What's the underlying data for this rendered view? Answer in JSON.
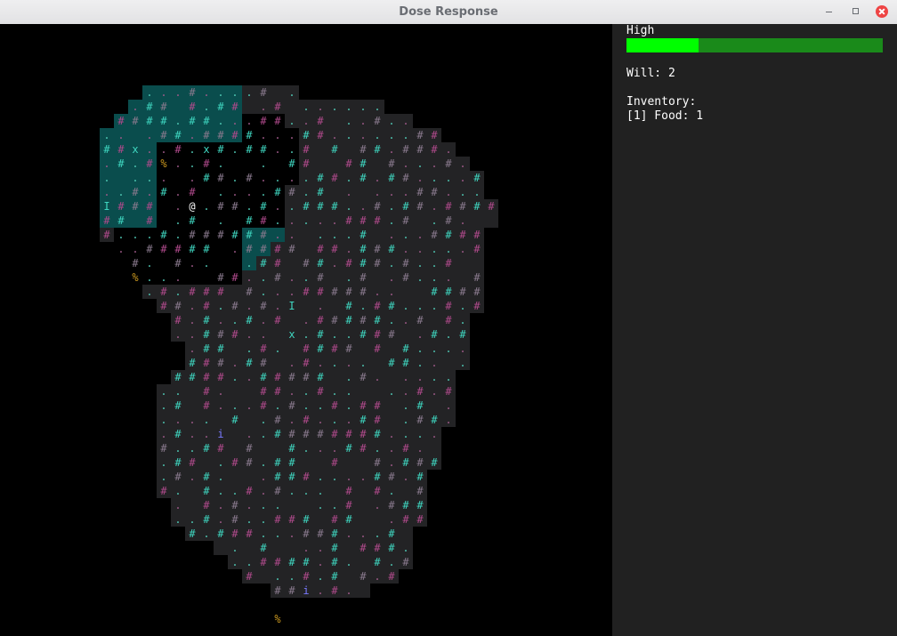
{
  "window": {
    "title": "Dose Response"
  },
  "sidebar": {
    "dose_label": "High",
    "dose_level": 0.28,
    "bar_fill_color": "#00ff00",
    "bar_empty_color": "#1a8a1a",
    "will": "Will: 2",
    "inventory_header": "Inventory:",
    "inventory_items": [
      "[1] Food: 1"
    ]
  },
  "map": {
    "player_glyph": "@",
    "colors": {
      "background": "#000000",
      "floor": "#232325",
      "highlight_floor": "#0a4d4d",
      "player": "#ffffff",
      "tree_teal": "#3fd6c0",
      "tree_pink": "#b04a8c",
      "tree_grey": "#8a7a8e",
      "dot_teal": "#4fc8b4",
      "dot_pink": "#a05a8a",
      "food": "#c8961e",
      "monster_teal": "#3fd6c0",
      "item_blue": "#7a7aff"
    },
    "markers": [
      {
        "glyph": "x",
        "kind": "monster"
      },
      {
        "glyph": "x",
        "kind": "monster"
      },
      {
        "glyph": "x",
        "kind": "monster"
      },
      {
        "glyph": "I",
        "kind": "monster"
      },
      {
        "glyph": "I",
        "kind": "monster"
      },
      {
        "glyph": "i",
        "kind": "item"
      },
      {
        "glyph": "i",
        "kind": "item"
      },
      {
        "glyph": "%",
        "kind": "food"
      },
      {
        "glyph": "%",
        "kind": "food"
      },
      {
        "glyph": "%",
        "kind": "food"
      }
    ]
  }
}
